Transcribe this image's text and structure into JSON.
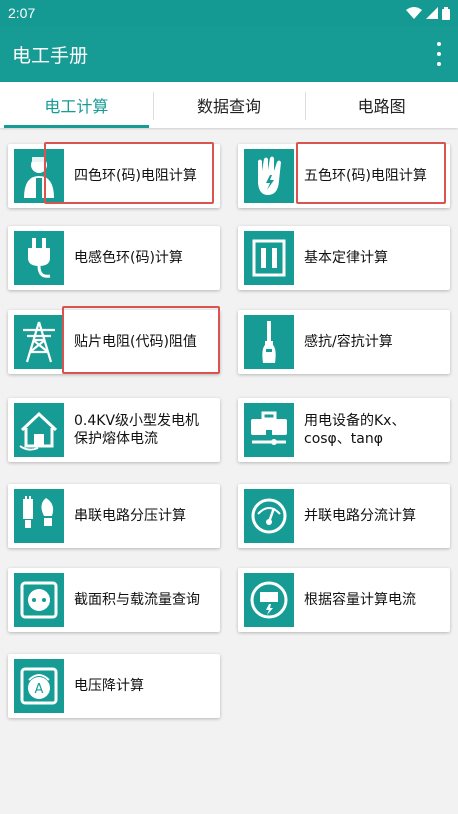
{
  "status_bar": {
    "time": "2:07"
  },
  "app_bar": {
    "title": "电工手册"
  },
  "tabs": [
    {
      "label": "电工计算",
      "active": true
    },
    {
      "label": "数据查询",
      "active": false
    },
    {
      "label": "电路图",
      "active": false
    }
  ],
  "items": [
    {
      "label": "四色环(码)电阻计算",
      "icon": "worker-icon",
      "highlighted": true
    },
    {
      "label": "五色环(码)电阻计算",
      "icon": "glove-icon",
      "highlighted": true
    },
    {
      "label": "电感色环(码)计算",
      "icon": "plug-icon",
      "highlighted": false
    },
    {
      "label": "基本定律计算",
      "icon": "switch-icon",
      "highlighted": false
    },
    {
      "label": "贴片电阻(代码)阻值",
      "icon": "pylon-icon",
      "highlighted": true
    },
    {
      "label": "感抗/容抗计算",
      "icon": "screwdriver-icon",
      "highlighted": false
    },
    {
      "label": "0.4KV级小型发电机保护熔体电流",
      "icon": "house-plug-icon",
      "highlighted": false
    },
    {
      "label": "用电设备的Kx、cosφ、tanφ",
      "icon": "toolbox-icon",
      "highlighted": false
    },
    {
      "label": "串联电路分压计算",
      "icon": "bulbs-icon",
      "highlighted": false
    },
    {
      "label": "并联电路分流计算",
      "icon": "gauge-icon",
      "highlighted": false
    },
    {
      "label": "截面积与载流量查询",
      "icon": "socket-icon",
      "highlighted": false
    },
    {
      "label": "根据容量计算电流",
      "icon": "meter-icon",
      "highlighted": false
    },
    {
      "label": "电压降计算",
      "icon": "ammeter-icon",
      "highlighted": false
    }
  ],
  "colors": {
    "primary": "#169c95",
    "highlight": "#d9534f"
  }
}
